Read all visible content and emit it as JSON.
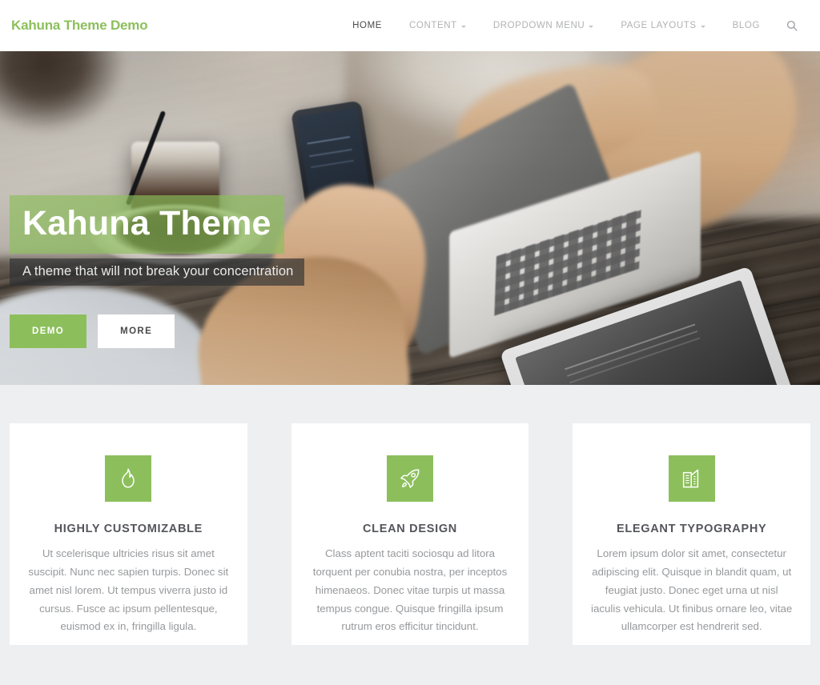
{
  "header": {
    "logo": "Kahuna Theme Demo",
    "nav": [
      {
        "label": "HOME",
        "has_caret": false,
        "active": true
      },
      {
        "label": "CONTENT",
        "has_caret": true,
        "active": false
      },
      {
        "label": "DROPDOWN MENU",
        "has_caret": true,
        "active": false
      },
      {
        "label": "PAGE LAYOUTS",
        "has_caret": true,
        "active": false
      },
      {
        "label": "BLOG",
        "has_caret": false,
        "active": false
      }
    ],
    "search_icon": "search-icon"
  },
  "hero": {
    "title": "Kahuna Theme",
    "subtitle": "A theme that will not break your concentration",
    "buttons": [
      {
        "label": "DEMO",
        "style": "primary"
      },
      {
        "label": "MORE",
        "style": "light"
      }
    ],
    "image_description": "Cafe desk scene with laptop, phone in hand, iced coffee and tablet on dark wood table"
  },
  "features": [
    {
      "icon": "flame-icon",
      "title": "HIGHLY CUSTOMIZABLE",
      "text": "Ut scelerisque ultricies risus sit amet suscipit. Nunc nec sapien turpis. Donec sit amet nisl lorem. Ut tempus viverra justo id cursus. Fusce ac ipsum pellentesque, euismod ex in, fringilla ligula."
    },
    {
      "icon": "rocket-icon",
      "title": "CLEAN DESIGN",
      "text": "Class aptent taciti sociosqu ad litora torquent per conubia nostra, per inceptos himenaeos. Donec vitae turpis ut massa tempus congue. Quisque fringilla ipsum rutrum eros efficitur tincidunt."
    },
    {
      "icon": "office-building-icon",
      "title": "ELEGANT TYPOGRAPHY",
      "text": "Lorem ipsum dolor sit amet, consectetur adipiscing elit. Quisque in blandit quam, ut feugiat justo. Donec eget urna ut nisl iaculis vehicula. Ut finibus ornare leo, vitae ullamcorper est hendrerit sed."
    }
  ],
  "colors": {
    "accent_green": "#8cbf5c",
    "page_background": "#edeff0",
    "card_background": "#ffffff",
    "nav_inactive": "#b0b2b4",
    "nav_active": "#4a4a4a",
    "body_text": "#97999c",
    "heading_text": "#53555a"
  }
}
